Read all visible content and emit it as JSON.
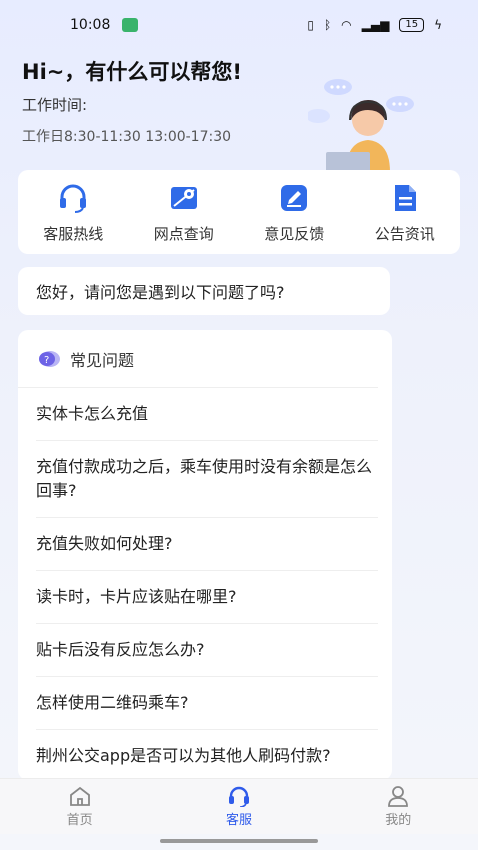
{
  "status_bar": {
    "time": "10:08",
    "battery": "15"
  },
  "hero": {
    "greeting": "Hi~，有什么可以帮您!",
    "work_label": "工作时间:",
    "work_hours": "工作日8:30-11:30 13:00-17:30"
  },
  "quick_actions": [
    {
      "label": "客服热线",
      "icon": "headset-icon"
    },
    {
      "label": "网点查询",
      "icon": "map-location-icon"
    },
    {
      "label": "意见反馈",
      "icon": "edit-icon"
    },
    {
      "label": "公告资讯",
      "icon": "document-icon"
    }
  ],
  "prompt": "您好，请问您是遇到以下问题了吗?",
  "faq": {
    "title": "常见问题",
    "items": [
      "实体卡怎么充值",
      "充值付款成功之后，乘车使用时没有余额是怎么回事?",
      "充值失败如何处理?",
      "读卡时，卡片应该贴在哪里?",
      "贴卡后没有反应怎么办?",
      "怎样使用二维码乘车?",
      "荆州公交app是否可以为其他人刷码付款?"
    ]
  },
  "tabbar": [
    {
      "label": "首页",
      "icon": "home-icon"
    },
    {
      "label": "客服",
      "icon": "headset-icon",
      "active": true
    },
    {
      "label": "我的",
      "icon": "user-icon"
    }
  ],
  "colors": {
    "accent": "#2f5bea",
    "icon_blue": "#2f6be8"
  }
}
